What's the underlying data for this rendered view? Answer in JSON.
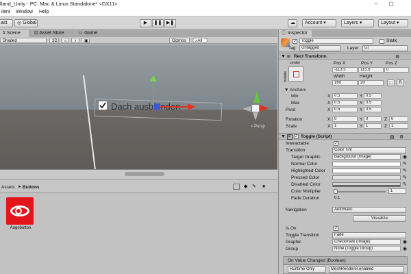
{
  "window": {
    "title": "lland_Unity - PC, Mac & Linux Standalone* <DX11>",
    "controls": [
      "–",
      "▢"
    ]
  },
  "menu": [
    "ilent",
    "Window",
    "Help"
  ],
  "toolbar": {
    "pivot_label": "ast",
    "global_label": "Global",
    "play": "▶",
    "pause": "❚❚",
    "step": "▶❚",
    "account_label": "Account",
    "layers_label": "Layers",
    "layout_label": "Layout"
  },
  "scene_tabs": [
    {
      "label": "Scene",
      "active": true
    },
    {
      "label": "Asset Store",
      "active": false
    },
    {
      "label": "Game",
      "active": false
    }
  ],
  "scene_toolbar": {
    "shading": "Shaded",
    "mode_2d": "2D",
    "gizmos": "Gizmos",
    "search_placeholder": "All"
  },
  "scene": {
    "toggle_text": "Dach ausblenden",
    "persp_label": "< Persp"
  },
  "project": {
    "breadcrumb_root": "Assets",
    "breadcrumb_sep": "►",
    "breadcrumb_folder": "Buttons",
    "asset_name": "Augebutton"
  },
  "inspector": {
    "tab_label": "Inspector",
    "object_name": "Toggle",
    "static_label": "Static",
    "tag_label": "Tag",
    "tag_value": "Untagged",
    "layer_label": "Layer",
    "layer_value": "UI",
    "rect_transform": {
      "title": "Rect Transform",
      "anchor_preset_top": "center",
      "anchor_preset_side": "middle",
      "pos_x_label": "Pos X",
      "pos_y_label": "Pos Y",
      "pos_z_label": "Pos Z",
      "pos_x": "-113.5",
      "pos_y": "115.6",
      "pos_z": "0",
      "width_label": "Width",
      "height_label": "Height",
      "width": "160",
      "height": "20",
      "r_button": "R",
      "anchors_label": "Anchors",
      "min_label": "Min",
      "max_label": "Max",
      "min_x": "0.5",
      "min_y": "0.5",
      "max_x": "0.5",
      "max_y": "0.5",
      "pivot_label": "Pivot",
      "pivot_x": "0.5",
      "pivot_y": "0.5",
      "rotation_label": "Rotation",
      "rot_x": "0",
      "rot_y": "0",
      "rot_z": "0",
      "scale_label": "Scale",
      "scale_x": "1",
      "scale_y": "1",
      "scale_z": "1",
      "x": "X",
      "y": "Y",
      "z": "Z"
    },
    "toggle_script": {
      "title": "Toggle (Script)",
      "interactable_label": "Interactable",
      "transition_label": "Transition",
      "transition_value": "Color Tint",
      "target_graphic_label": "Target Graphic",
      "target_graphic_value": "Background (Image)",
      "normal_color_label": "Normal Color",
      "highlighted_color_label": "Highlighted Color",
      "pressed_color_label": "Pressed Color",
      "disabled_color_label": "Disabled Color",
      "color_multiplier_label": "Color Multiplier",
      "color_multiplier_value": "1",
      "fade_duration_label": "Fade Duration",
      "fade_duration_value": "0.1",
      "navigation_label": "Navigation",
      "navigation_value": "Automatic",
      "visualize_label": "Visualize",
      "is_on_label": "Is On",
      "toggle_transition_label": "Toggle Transition",
      "toggle_transition_value": "Fade",
      "graphic_label": "Graphic",
      "graphic_value": "Checkmark (Image)",
      "group_label": "Group",
      "group_value": "None (Toggle Group)",
      "event_label": "On Value Changed (Boolean)",
      "runtime_value": "Runtime Only",
      "event_target": "MeshRenderer.enabled"
    }
  },
  "colors": {
    "accent_blue": "#1d4e9c",
    "asset_red": "#e3141a",
    "axis_green": "#5cbd34",
    "axis_red": "#d9351e"
  }
}
